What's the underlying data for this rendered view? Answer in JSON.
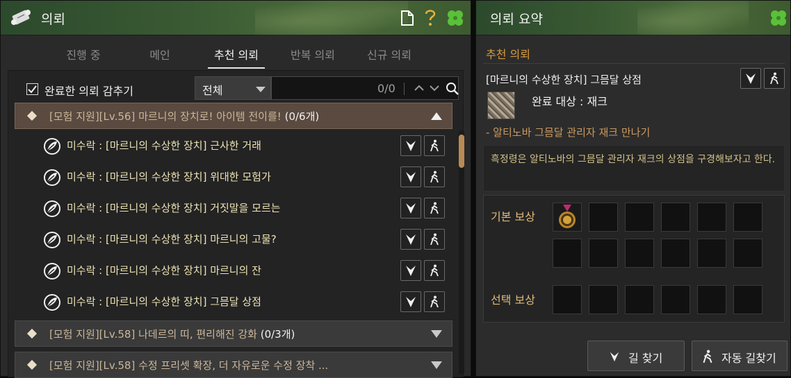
{
  "left": {
    "title": "의뢰",
    "tabs": [
      {
        "label": "진행 중"
      },
      {
        "label": "메인"
      },
      {
        "label": "추천 의뢰"
      },
      {
        "label": "반복 의뢰"
      },
      {
        "label": "신규 의뢰"
      }
    ],
    "active_tab": "추천 의뢰",
    "filter": {
      "hide_completed_label": "완료한 의뢰 감추기",
      "hide_completed_checked": true,
      "category_value": "전체",
      "search_count": "0/0"
    },
    "groups": [
      {
        "label": "[모험 지원][Lv.56] 마르니의 장치로! 아이템 전이를!",
        "count": "(0/6개)",
        "expanded": true,
        "quests": [
          {
            "label": "미수락 : [마르니의 수상한 장치] 근사한 거래"
          },
          {
            "label": "미수락 : [마르니의 수상한 장치] 위대한 모험가"
          },
          {
            "label": "미수락 : [마르니의 수상한 장치] 거짓말을 모르는"
          },
          {
            "label": "미수락 : [마르니의 수상한 장치] 마르니의 고물?"
          },
          {
            "label": "미수락 : [마르니의 수상한 장치] 마르니의 잔"
          },
          {
            "label": "미수락 : [마르니의 수상한 장치] 그믐달 상점"
          }
        ]
      },
      {
        "label": "[모험 지원][Lv.58] 나데르의 띠, 편리해진 강화",
        "count": "(0/3개)",
        "expanded": false
      },
      {
        "label": "[모험 지원][Lv.58] 수정 프리셋 확장, 더 자유로운 수정 장착 ...",
        "count": "",
        "expanded": false
      }
    ]
  },
  "right": {
    "title": "의뢰 요약",
    "section": "추천 의뢰",
    "quest_title": "[마르니의 수상한 장치] 그믐달 상점",
    "target": "완료 대상 : 재크",
    "objective": "- 알티노바 그믐달 관리자 재크 만나기",
    "description": "흑정령은 알티노바의 그믐달 관리자 재크의 상점을 구경해보자고 한다.",
    "basic_reward_label": "기본 보상",
    "choice_reward_label": "선택 보상",
    "find_path_label": "길 찾기",
    "auto_path_label": "자동 길찾기"
  },
  "colors": {
    "title_bar": "#3a5a33",
    "accent_orange": "#d79a3a",
    "quest_text": "#ede3b4",
    "group_open": "#5a4a40"
  },
  "icons": [
    "scroll-icon",
    "document-icon",
    "help-icon",
    "clover-icon",
    "checkmark-icon",
    "search-icon",
    "chevron-up-icon",
    "chevron-down-icon",
    "quest-leaf-icon",
    "waypoint-icon",
    "walking-person-icon",
    "medal-icon"
  ]
}
